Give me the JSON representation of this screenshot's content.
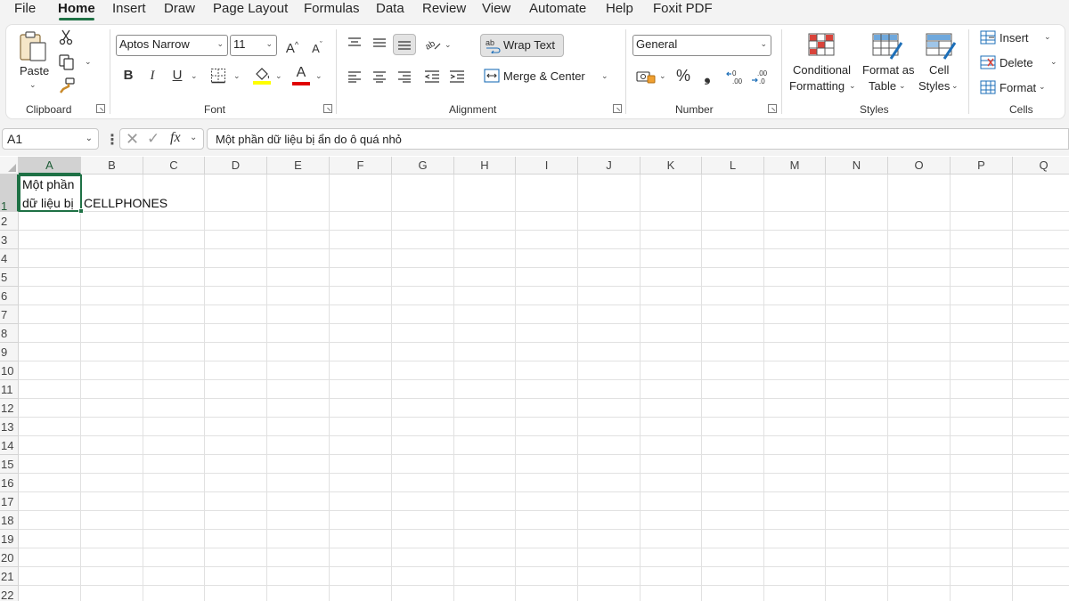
{
  "menu": {
    "tabs": [
      "File",
      "Home",
      "Insert",
      "Draw",
      "Page Layout",
      "Formulas",
      "Data",
      "Review",
      "View",
      "Automate",
      "Help",
      "Foxit PDF"
    ],
    "active": "Home"
  },
  "ribbon": {
    "clipboard": {
      "group_label": "Clipboard",
      "paste_label": "Paste",
      "icons": [
        "paste-icon",
        "cut-icon",
        "copy-icon",
        "format-painter-icon"
      ]
    },
    "font": {
      "group_label": "Font",
      "font_name": "Aptos Narrow",
      "font_size": "11",
      "grow_label": "A",
      "shrink_label": "A",
      "bold_label": "B",
      "italic_label": "I",
      "underline_label": "U",
      "font_color_label": "A",
      "highlight_color": "#ffff00",
      "font_color": "#e00000"
    },
    "alignment": {
      "group_label": "Alignment",
      "wrap_text_label": "Wrap Text",
      "merge_center_label": "Merge & Center"
    },
    "number": {
      "group_label": "Number",
      "format": "General",
      "percent_label": "%",
      "comma_label": "❟"
    },
    "styles": {
      "group_label": "Styles",
      "conditional_l1": "Conditional",
      "conditional_l2": "Formatting",
      "format_table_l1": "Format as",
      "format_table_l2": "Table",
      "cell_styles_l1": "Cell",
      "cell_styles_l2": "Styles"
    },
    "cells": {
      "group_label": "Cells",
      "insert_label": "Insert",
      "delete_label": "Delete",
      "format_label": "Format"
    }
  },
  "formula_bar": {
    "name_box": "A1",
    "fx_label": "fx",
    "formula": "Một phần dữ liệu bị ẩn do ô quá nhỏ"
  },
  "sheet": {
    "columns": [
      "A",
      "B",
      "C",
      "D",
      "E",
      "F",
      "G",
      "H",
      "I",
      "J",
      "K",
      "L",
      "M",
      "N",
      "O",
      "P",
      "Q"
    ],
    "rows": [
      "1",
      "2",
      "3",
      "4",
      "5",
      "6",
      "7",
      "8",
      "9",
      "10",
      "11",
      "12",
      "13",
      "14",
      "15",
      "16",
      "17",
      "18",
      "19",
      "20",
      "21",
      "22"
    ],
    "selected_cell": "A1",
    "a1_line1": "Một phần",
    "a1_line2": "dữ liệu bị",
    "b1": "CELLPHONES"
  },
  "colors": {
    "accent": "#1e7145",
    "ribbon_bg": "#f3f3f3"
  }
}
